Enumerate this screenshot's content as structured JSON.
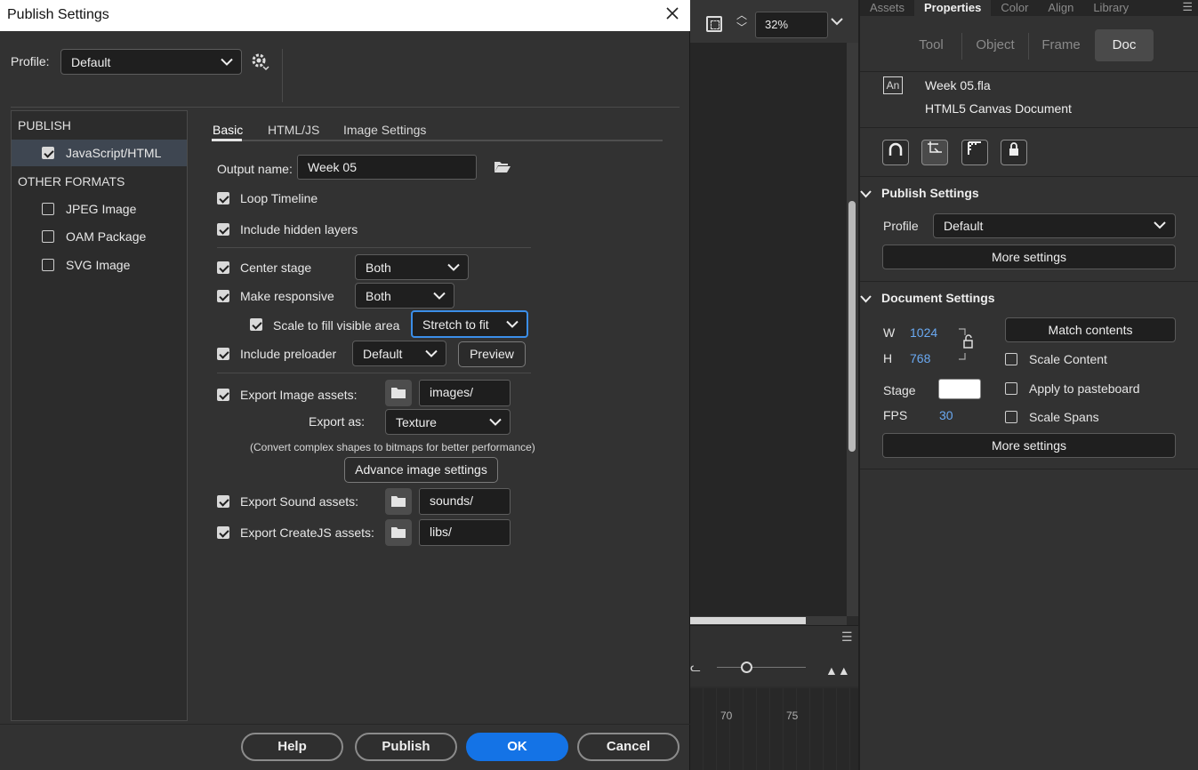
{
  "dialog": {
    "title": "Publish Settings",
    "profile_label": "Profile:",
    "profile_value": "Default",
    "left_panel": {
      "publish_header": "PUBLISH",
      "publish_items": [
        {
          "label": "JavaScript/HTML",
          "checked": true
        }
      ],
      "other_header": "OTHER FORMATS",
      "other_items": [
        {
          "label": "JPEG Image",
          "checked": false
        },
        {
          "label": "OAM Package",
          "checked": false
        },
        {
          "label": "SVG Image",
          "checked": false
        }
      ]
    },
    "tabs": [
      "Basic",
      "HTML/JS",
      "Image Settings"
    ],
    "active_tab": "Basic",
    "basic": {
      "output_name_label": "Output name:",
      "output_name_value": "Week 05",
      "loop_timeline": "Loop Timeline",
      "include_hidden_layers": "Include hidden layers",
      "center_stage": "Center stage",
      "center_stage_value": "Both",
      "make_responsive": "Make responsive",
      "make_responsive_value": "Both",
      "scale_to_fill": "Scale to fill visible area",
      "scale_to_fill_value": "Stretch to fit",
      "include_preloader": "Include preloader",
      "include_preloader_value": "Default",
      "preview_button": "Preview",
      "export_image_assets": "Export Image assets:",
      "export_image_path": "images/",
      "export_as_label": "Export as:",
      "export_as_value": "Texture",
      "convert_note": "(Convert complex shapes to bitmaps for better performance)",
      "advance_image_button": "Advance image settings",
      "export_sound_assets": "Export Sound assets:",
      "export_sound_path": "sounds/",
      "export_createjs_assets": "Export CreateJS assets:",
      "export_createjs_path": "libs/"
    },
    "footer": {
      "help": "Help",
      "publish": "Publish",
      "ok": "OK",
      "cancel": "Cancel"
    }
  },
  "stage": {
    "zoom": "32%",
    "timeline_frames": [
      "70",
      "75"
    ]
  },
  "properties": {
    "tabs": [
      "Assets",
      "Properties",
      "Color",
      "Align",
      "Library"
    ],
    "active_tab": "Properties",
    "modes": [
      "Tool",
      "Object",
      "Frame",
      "Doc"
    ],
    "active_mode": "Doc",
    "doc_icon": "An",
    "doc_name": "Week 05.fla",
    "doc_type": "HTML5 Canvas Document",
    "publish_settings": {
      "title": "Publish Settings",
      "profile_label": "Profile",
      "profile_value": "Default",
      "more_settings": "More settings"
    },
    "document_settings": {
      "title": "Document Settings",
      "w_label": "W",
      "w_value": "1024",
      "h_label": "H",
      "h_value": "768",
      "match_contents": "Match contents",
      "scale_content": "Scale Content",
      "stage_label": "Stage",
      "stage_color": "#ffffff",
      "apply_to_pasteboard": "Apply to pasteboard",
      "fps_label": "FPS",
      "fps_value": "30",
      "scale_spans": "Scale Spans",
      "more_settings": "More settings"
    }
  },
  "colors": {
    "accent": "#1473e6",
    "focus": "#3b8ee8",
    "link_value": "#6aa9f2"
  }
}
